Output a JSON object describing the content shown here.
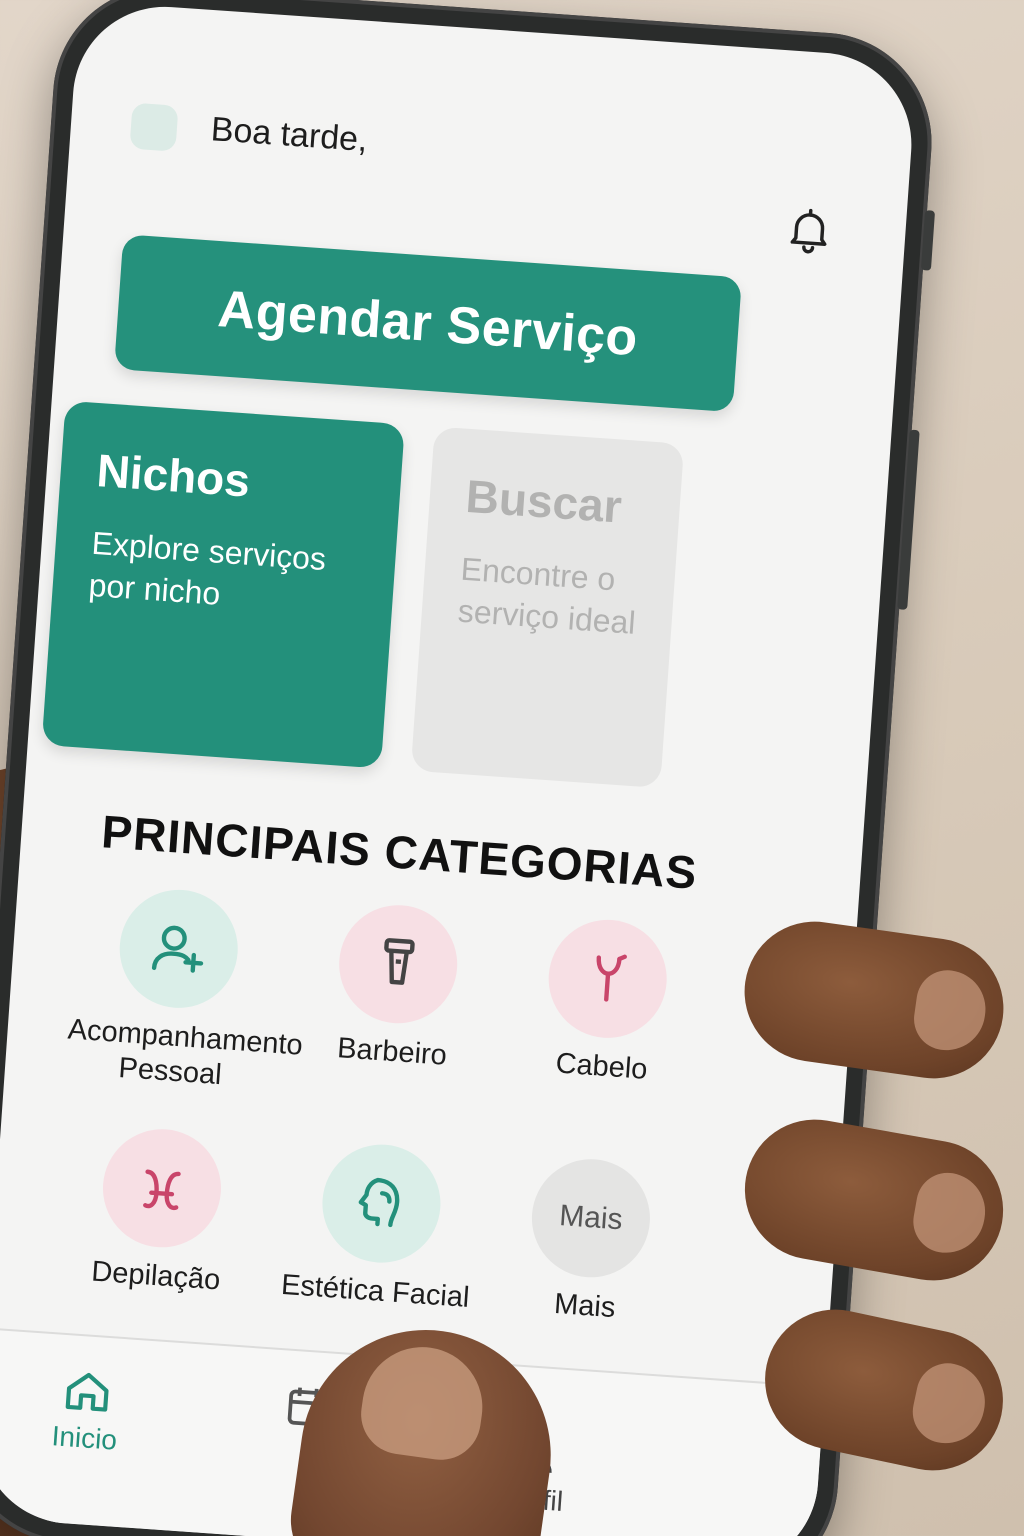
{
  "header": {
    "greeting": "Boa tarde,",
    "avatar_icon": "avatar-placeholder",
    "notification_icon": "bell-icon"
  },
  "primary_action": {
    "label": "Agendar Serviço"
  },
  "cards": {
    "nichos": {
      "title": "Nichos",
      "subtitle": "Explore serviços por nicho"
    },
    "buscar": {
      "title": "Buscar",
      "subtitle": "Encontre o serviço ideal"
    }
  },
  "categories": {
    "title": "PRINCIPAIS CATEGORIAS",
    "items": [
      {
        "label": "Acompanhamento Pessoal",
        "icon": "user-plus-icon",
        "color": "#daeee8"
      },
      {
        "label": "Barbeiro",
        "icon": "razor-icon",
        "color": "#f7dfe4"
      },
      {
        "label": "Cabelo",
        "icon": "hair-tool-icon",
        "color": "#f7dfe4"
      },
      {
        "label": "Depilação",
        "icon": "depilation-icon",
        "color": "#f7dfe4"
      },
      {
        "label": "Estética Facial",
        "icon": "face-icon",
        "color": "#daeee8"
      },
      {
        "label": "Mais",
        "icon_text": "Mais",
        "color": "#e4e4e3"
      }
    ]
  },
  "tabbar": {
    "items": [
      {
        "label": "Inicio",
        "icon": "home-icon",
        "active": true
      },
      {
        "label": "",
        "icon": "calendar-icon",
        "active": false
      },
      {
        "label": "Perfil",
        "icon": "user-icon",
        "active": false
      }
    ]
  },
  "colors": {
    "accent": "#25917c",
    "accent_light": "#daeee8",
    "pink_light": "#f7dfe4",
    "card_disabled": "#e6e6e5"
  }
}
